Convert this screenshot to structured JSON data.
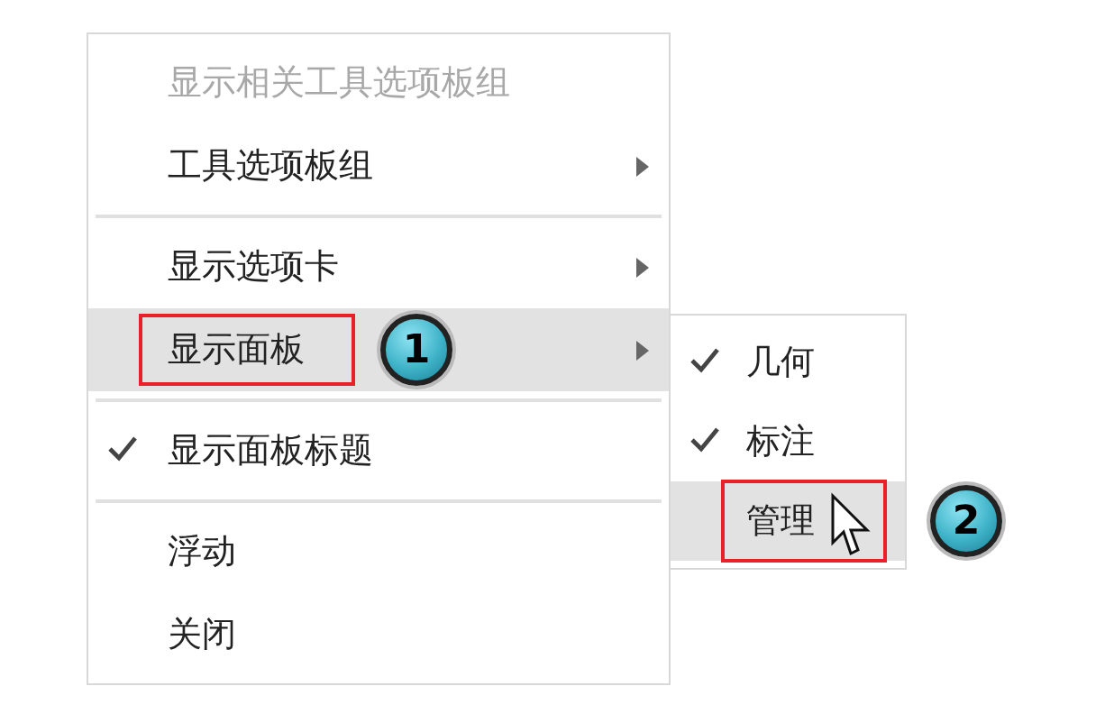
{
  "menu": {
    "items": [
      {
        "kind": "item",
        "label": "显示相关工具选项板组",
        "disabled": true,
        "checked": false,
        "submenu": false,
        "selected": false,
        "highlighted": false
      },
      {
        "kind": "item",
        "label": "工具选项板组",
        "disabled": false,
        "checked": false,
        "submenu": true,
        "selected": false,
        "highlighted": false
      },
      {
        "kind": "separator"
      },
      {
        "kind": "item",
        "label": "显示选项卡",
        "disabled": false,
        "checked": false,
        "submenu": true,
        "selected": false,
        "highlighted": false
      },
      {
        "kind": "item",
        "label": "显示面板",
        "disabled": false,
        "checked": false,
        "submenu": true,
        "selected": true,
        "highlighted": true,
        "callout": "1",
        "children": [
          {
            "label": "几何",
            "checked": true,
            "selected": false,
            "highlighted": false,
            "pointer": false
          },
          {
            "label": "标注",
            "checked": true,
            "selected": false,
            "highlighted": false,
            "pointer": false
          },
          {
            "label": "管理",
            "checked": false,
            "selected": true,
            "highlighted": true,
            "pointer": true,
            "callout": "2"
          }
        ]
      },
      {
        "kind": "separator"
      },
      {
        "kind": "item",
        "label": "显示面板标题",
        "disabled": false,
        "checked": true,
        "submenu": false,
        "selected": false,
        "highlighted": false
      },
      {
        "kind": "separator"
      },
      {
        "kind": "item",
        "label": "浮动",
        "disabled": false,
        "checked": false,
        "submenu": false,
        "selected": false,
        "highlighted": false
      },
      {
        "kind": "item",
        "label": "关闭",
        "disabled": false,
        "checked": false,
        "submenu": false,
        "selected": false,
        "highlighted": false
      }
    ]
  }
}
